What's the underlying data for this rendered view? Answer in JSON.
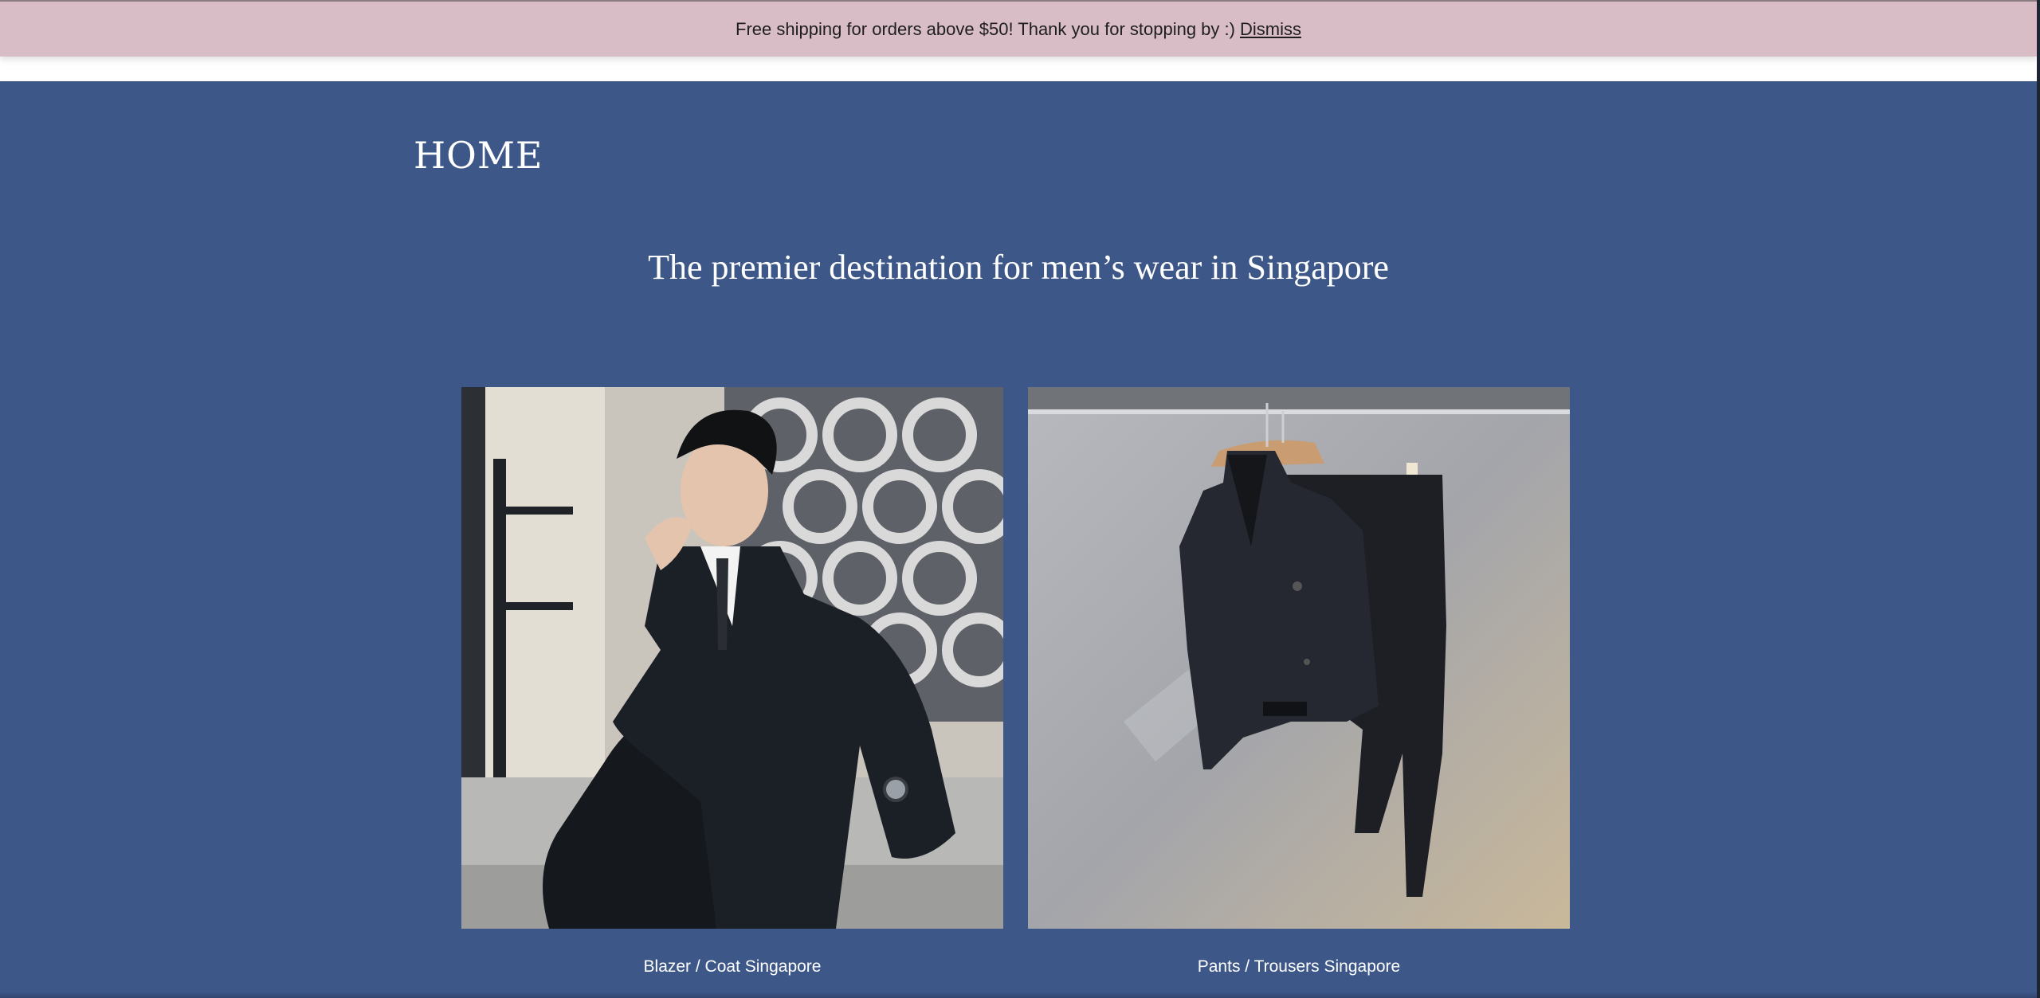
{
  "announcement": {
    "message": "Free shipping for orders above $50! Thank you for stopping by :)",
    "dismiss_label": "Dismiss"
  },
  "page": {
    "title": "HOME",
    "tagline": "The premier destination for men’s wear in Singapore"
  },
  "collections": [
    {
      "label": "Blazer / Coat Singapore",
      "image": "man-in-pinstripe-suit-photo"
    },
    {
      "label": "Pants / Trousers Singapore",
      "image": "suit-on-hanger-photo"
    }
  ],
  "colors": {
    "banner_bg": "#d8bcc6",
    "page_bg": "#3d5788",
    "text_light": "#ffffff"
  }
}
